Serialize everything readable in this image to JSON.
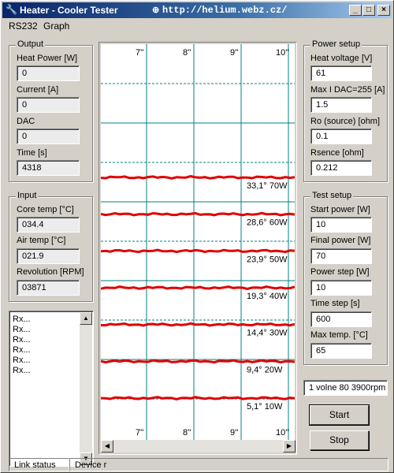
{
  "window": {
    "title": "Heater - Cooler Tester",
    "url": "http://helium.webz.cz/",
    "controls": {
      "minimize": "_",
      "maximize": "□",
      "close": "×"
    }
  },
  "menu": [
    "RS232",
    "Graph"
  ],
  "output": {
    "legend": "Output",
    "fields": [
      {
        "label": "Heat Power  [W]",
        "value": "0"
      },
      {
        "label": "Current  [A]",
        "value": "0"
      },
      {
        "label": "DAC",
        "value": "0"
      },
      {
        "label": "Time  [s]",
        "value": "4318"
      }
    ]
  },
  "input": {
    "legend": "Input",
    "fields": [
      {
        "label": "Core temp  [°C]",
        "value": "034.4"
      },
      {
        "label": "Air temp  [°C]",
        "value": "021.9"
      },
      {
        "label": "Revolution [RPM]",
        "value": "03871"
      }
    ]
  },
  "log": {
    "items": [
      "Rx...",
      "Rx...",
      "Rx...",
      "Rx...",
      "Rx...",
      "Rx..."
    ]
  },
  "power_setup": {
    "legend": "Power setup",
    "fields": [
      {
        "label": "Heat voltage [V]",
        "value": "61"
      },
      {
        "label": "Max I DAC=255 [A]",
        "value": "1.5"
      },
      {
        "label": "Ro (source)  [ohm]",
        "value": "0.1"
      },
      {
        "label": "Rsence   [ohm]",
        "value": "0.212"
      }
    ]
  },
  "test_setup": {
    "legend": "Test setup",
    "fields": [
      {
        "label": "Start power  [W]",
        "value": "10"
      },
      {
        "label": "Final power  [W]",
        "value": "70"
      },
      {
        "label": "Power step  [W]",
        "value": "10"
      },
      {
        "label": "Time step  [s]",
        "value": "600"
      },
      {
        "label": "Max temp.  [°C]",
        "value": "65"
      }
    ]
  },
  "result": "1 volne 80 3900rpm",
  "buttons": {
    "start": "Start",
    "stop": "Stop"
  },
  "status": {
    "link": "Link status",
    "device": "Device r"
  },
  "chart_data": {
    "type": "line",
    "x_ticks": [
      "7''",
      "8''",
      "9''",
      "10''"
    ],
    "line_color": "#e00000",
    "grid_color": "#008080",
    "series": [
      {
        "label": "33,1° 70W",
        "power_w": 70
      },
      {
        "label": "28,6° 60W",
        "power_w": 60
      },
      {
        "label": "23,9° 50W",
        "power_w": 50
      },
      {
        "label": "19,3° 40W",
        "power_w": 40
      },
      {
        "label": "14,4° 30W",
        "power_w": 30
      },
      {
        "label": "9,4° 20W",
        "power_w": 20
      },
      {
        "label": "5,1° 10W",
        "power_w": 10
      }
    ]
  }
}
